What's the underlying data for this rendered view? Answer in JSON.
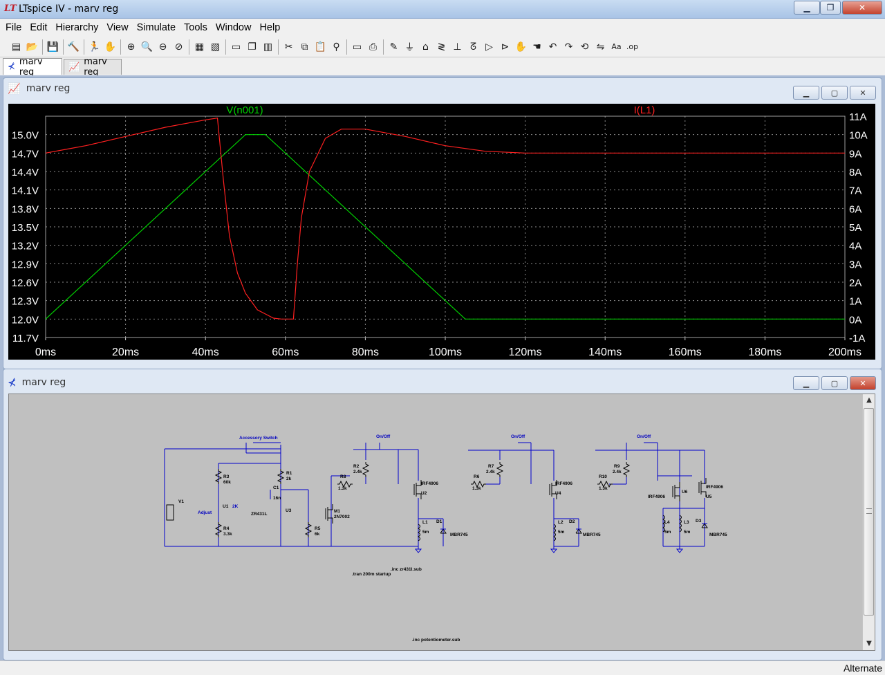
{
  "window": {
    "title": "LTspice IV - marv reg",
    "logo": "LT"
  },
  "menu": [
    "File",
    "Edit",
    "Hierarchy",
    "View",
    "Simulate",
    "Tools",
    "Window",
    "Help"
  ],
  "toolbar_icons": [
    "new-schematic",
    "open",
    "|",
    "save",
    "|",
    "control-panel",
    "|",
    "run",
    "halt",
    "|",
    "zoom-in",
    "zoom-area",
    "zoom-out",
    "zoom-cancel",
    "|",
    "autorange",
    "mark-unconnected",
    "|",
    "tile-horizontal",
    "cascade",
    "tile-vertical",
    "|",
    "cut",
    "copy",
    "paste",
    "find",
    "|",
    "print-setup",
    "print",
    "|",
    "draw-wire",
    "ground",
    "label-net",
    "resistor",
    "capacitor",
    "inductor",
    "diode",
    "component",
    "move",
    "drag",
    "undo",
    "redo",
    "rotate",
    "mirror",
    "text",
    "spice-directive"
  ],
  "tabs": [
    {
      "label": "marv reg",
      "icon": "schematic-icon",
      "active": true
    },
    {
      "label": "marv reg",
      "icon": "waveform-icon",
      "active": false
    }
  ],
  "plot_window": {
    "title": "marv reg",
    "icon": "waveform-icon",
    "buttons": [
      "minimize",
      "maximize",
      "close"
    ]
  },
  "schematic_window": {
    "title": "marv reg",
    "icon": "schematic-icon",
    "buttons": [
      "minimize",
      "maximize",
      "close"
    ]
  },
  "colors": {
    "plot_bg": "#000000",
    "grid": "#8c8c8c",
    "trace_v": "#00d000",
    "trace_i": "#ff2020",
    "wire": "#0000cc",
    "schem_bg": "#c0c0c0"
  },
  "chart_data": {
    "type": "line",
    "x": {
      "unit": "ms",
      "range": [
        0,
        200
      ],
      "ticks": [
        "0ms",
        "20ms",
        "40ms",
        "60ms",
        "80ms",
        "100ms",
        "120ms",
        "140ms",
        "160ms",
        "180ms",
        "200ms"
      ]
    },
    "y_left": {
      "range": [
        11.7,
        15.3
      ],
      "ticks": [
        "15.0V",
        "14.7V",
        "14.4V",
        "14.1V",
        "13.8V",
        "13.5V",
        "13.2V",
        "12.9V",
        "12.6V",
        "12.3V",
        "12.0V",
        "11.7V"
      ]
    },
    "y_right": {
      "range": [
        -1,
        11
      ],
      "ticks": [
        "11A",
        "10A",
        "9A",
        "8A",
        "7A",
        "6A",
        "5A",
        "4A",
        "3A",
        "2A",
        "1A",
        "0A",
        "-1A"
      ]
    },
    "grid": true,
    "series": [
      {
        "name": "V(n001)",
        "axis": "left",
        "x": [
          0,
          50,
          55,
          105,
          200
        ],
        "y": [
          12.0,
          15.0,
          15.0,
          12.0,
          12.0
        ]
      },
      {
        "name": "I(L1)",
        "axis": "right",
        "x": [
          0,
          5,
          10,
          20,
          30,
          40,
          43,
          44.5,
          46,
          48,
          50,
          53,
          57,
          59,
          62,
          63,
          64,
          66,
          70,
          74,
          80,
          90,
          100,
          110,
          120,
          200
        ],
        "y": [
          9.0,
          9.2,
          9.4,
          9.9,
          10.4,
          10.8,
          10.9,
          7.5,
          4.5,
          2.5,
          1.4,
          0.5,
          0.05,
          0.0,
          0.0,
          3.0,
          5.5,
          8.0,
          9.8,
          10.3,
          10.3,
          9.9,
          9.4,
          9.1,
          9.0,
          9.0
        ]
      }
    ]
  },
  "schematic": {
    "labels": [
      "Accessory Switch",
      "On/Off",
      "On/Off",
      "On/Off",
      "R3",
      "60k",
      "R1",
      "2k",
      "C1",
      "16n",
      "U3",
      "ZR431L",
      "Adjust",
      "U1",
      "2K",
      "R4",
      "3.3k",
      "V1",
      "R5",
      "6k",
      "M1",
      "2N7002",
      "R8",
      "1.3k",
      "R2",
      "2.4k",
      "IRF4906",
      "U2",
      "L1",
      "5m",
      "D1",
      "MBR745",
      "R7",
      "2.4k",
      "R6",
      "1.3k",
      "IRF4906",
      "U4",
      "L2",
      "5m",
      "D2",
      "MBR745",
      "R9",
      "2.4k",
      "R10",
      "1.3k",
      "IRF4906",
      "U6",
      "IRF4906",
      "U5",
      "L4",
      "5m",
      "L3",
      "5m",
      "D3",
      "MBR745",
      ".inc zr431l.sub",
      ".tran 200m startup",
      ".inc potentiometer.sub"
    ]
  },
  "status": "Alternate"
}
